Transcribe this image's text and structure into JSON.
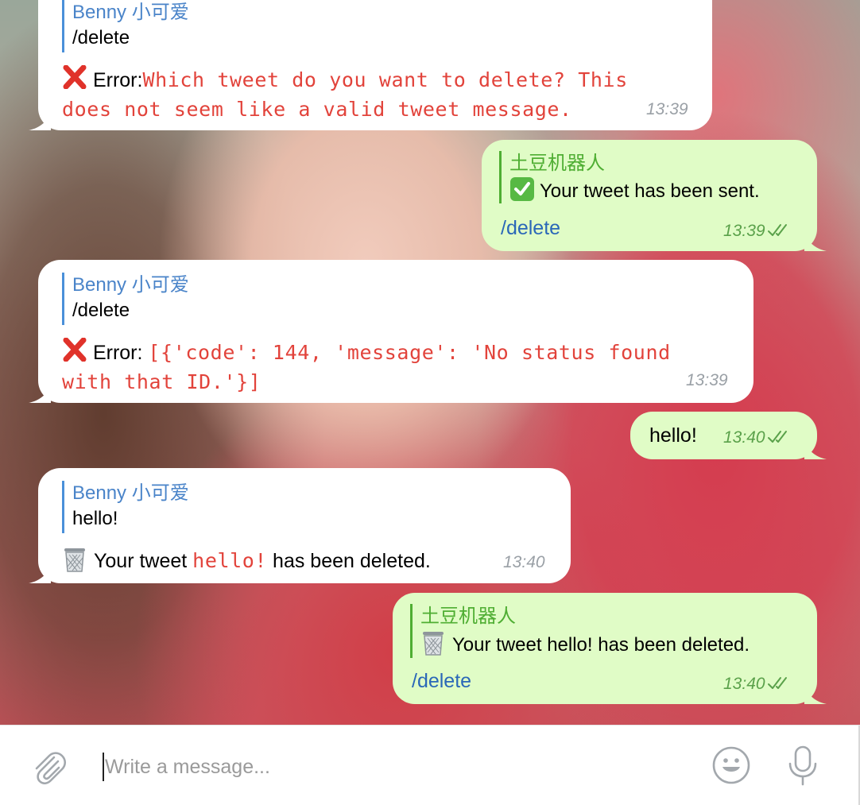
{
  "colors": {
    "incoming_bg": "#ffffff",
    "outgoing_bg": "#e0fcc6",
    "reply_blue": "#4a84c9",
    "reply_green": "#4fae33",
    "error_red": "#e2433b",
    "command_blue": "#2a67b8"
  },
  "messages": [
    {
      "direction": "incoming",
      "reply_author": "Benny 小可爱",
      "reply_text": "/delete",
      "error_prefix": "Error:",
      "error_line1": "Which tweet do you want to delete? This",
      "error_line2": "does not seem like a valid tweet message.",
      "time": "13:39"
    },
    {
      "direction": "outgoing",
      "reply_author": "土豆机器人",
      "reply_text": "Your tweet has been sent.",
      "command": "/delete",
      "time": "13:39"
    },
    {
      "direction": "incoming",
      "reply_author": "Benny 小可爱",
      "reply_text": "/delete",
      "error_prefix": "Error:",
      "error_line1": "[{'code': 144, 'message': 'No status found",
      "error_line2": "with that ID.'}]",
      "time": "13:39"
    },
    {
      "direction": "outgoing",
      "text": "hello!",
      "time": "13:40"
    },
    {
      "direction": "incoming",
      "reply_author": "Benny 小可爱",
      "reply_text": "hello!",
      "text_before": "Your tweet",
      "highlight": "hello!",
      "text_after": "has been deleted.",
      "time": "13:40"
    },
    {
      "direction": "outgoing",
      "reply_author": "土豆机器人",
      "reply_text": "Your tweet hello! has been deleted.",
      "command": "/delete",
      "time": "13:40"
    }
  ],
  "composer": {
    "placeholder": "Write a message..."
  },
  "icons": {
    "attach": "paperclip-icon",
    "emoji": "smiley-icon",
    "voice": "microphone-icon",
    "error": "cross-mark-icon",
    "success": "check-mark-icon",
    "deleted": "wastebasket-icon",
    "read": "double-check-icon"
  }
}
